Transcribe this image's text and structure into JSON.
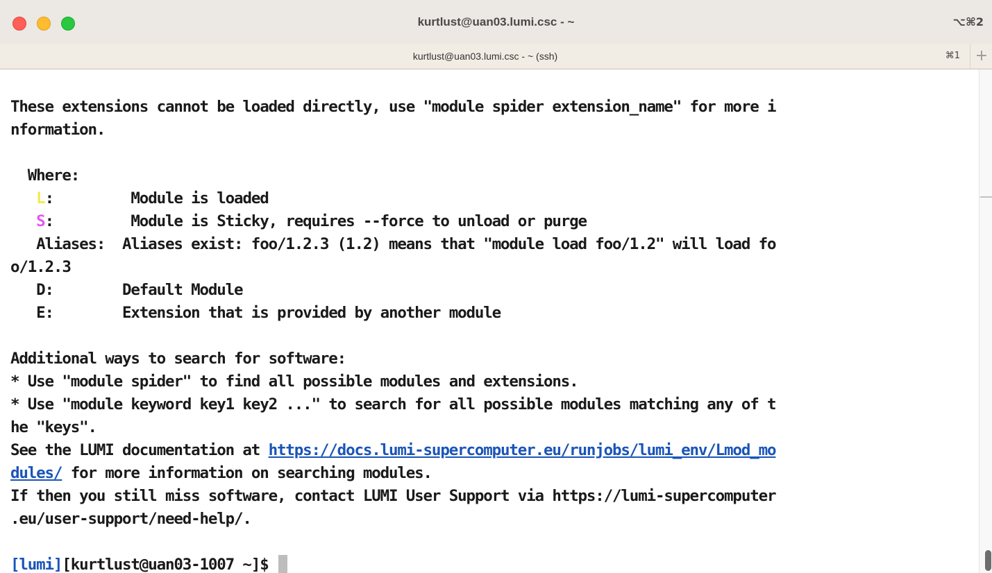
{
  "window": {
    "title": "kurtlust@uan03.lumi.csc - ~",
    "shortcut": "⌥⌘2"
  },
  "tab": {
    "title": "kurtlust@uan03.lumi.csc - ~ (ssh)",
    "shortcut": "⌘1",
    "new_tab_symbol": "+"
  },
  "terminal": {
    "lines": {
      "l1": "These extensions cannot be loaded directly, use \"module spider extension_name\" for more i",
      "l2": "nformation.",
      "l4": "  Where:",
      "l5_sym": "L",
      "l5_rest": ":         Module is loaded",
      "l6_sym": "S",
      "l6_rest": ":         Module is Sticky, requires --force to unload or purge",
      "l7": "   Aliases:  Aliases exist: foo/1.2.3 (1.2) means that \"module load foo/1.2\" will load fo",
      "l8": "o/1.2.3",
      "l9": "   D:        Default Module",
      "l10": "   E:        Extension that is provided by another module",
      "l12": "Additional ways to search for software:",
      "l13": "* Use \"module spider\" to find all possible modules and extensions.",
      "l14": "* Use \"module keyword key1 key2 ...\" to search for all possible modules matching any of t",
      "l15": "he \"keys\".",
      "l16_pre": "See the LUMI documentation at ",
      "l16_link": "https://docs.lumi-supercomputer.eu/runjobs/lumi_env/Lmod_mo",
      "l17_link": "dules/",
      "l17_post": " for more information on searching modules.",
      "l18": "If then you still miss software, contact LUMI User Support via https://lumi-supercomputer",
      "l19": ".eu/user-support/need-help/.",
      "prompt_tag": "[lumi]",
      "prompt_rest": "[kurtlust@uan03-1007 ~]$ "
    }
  },
  "colors": {
    "loaded_marker": "#f2e94e",
    "sticky_marker": "#e458f0",
    "link": "#1a55b8",
    "text": "#1a1a1a"
  }
}
